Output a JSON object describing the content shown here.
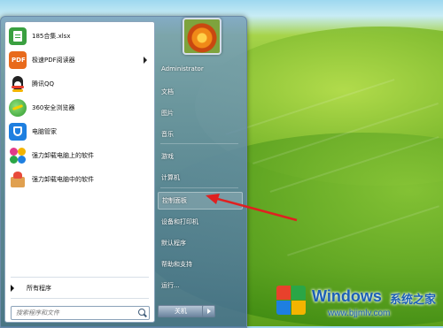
{
  "start_menu": {
    "programs": [
      {
        "label": "185合集.xlsx",
        "icon": "spreadsheet-icon",
        "color": "#3aa040"
      },
      {
        "label": "极速PDF阅读器",
        "icon": "pdf-reader-icon",
        "color": "#e86a1c",
        "has_submenu": true
      },
      {
        "label": "腾讯QQ",
        "icon": "qq-penguin-icon",
        "color": "#222222"
      },
      {
        "label": "360安全浏览器",
        "icon": "360-browser-icon",
        "color": "#3ba83a"
      },
      {
        "label": "电脑管家",
        "icon": "pc-manager-shield-icon",
        "color": "#1e7fe0"
      },
      {
        "label": "强力卸载电脑上的软件",
        "icon": "uninstaller-icon",
        "color": "#e23a8a"
      },
      {
        "label": "强力卸载电脑中的软件",
        "icon": "uninstaller-box-icon",
        "color": "#e0a050"
      }
    ],
    "all_programs": "所有程序",
    "search": {
      "placeholder": "搜索程序和文件"
    },
    "right": {
      "username": "Administrator",
      "items": [
        "文档",
        "图片",
        "音乐",
        "游戏",
        "计算机",
        "控制面板",
        "设备和打印机",
        "默认程序",
        "帮助和支持",
        "运行..."
      ]
    },
    "shutdown_label": "关机"
  },
  "watermark": {
    "brand": "Windows",
    "subtitle": "系统之家",
    "url": "www.bjjmlv.com",
    "logo_colors": [
      "#e8412c",
      "#2aa646",
      "#1e7fe0",
      "#f4b400"
    ]
  },
  "annotation": {
    "arrow_color": "#e02020",
    "points_to": "控制面板"
  }
}
